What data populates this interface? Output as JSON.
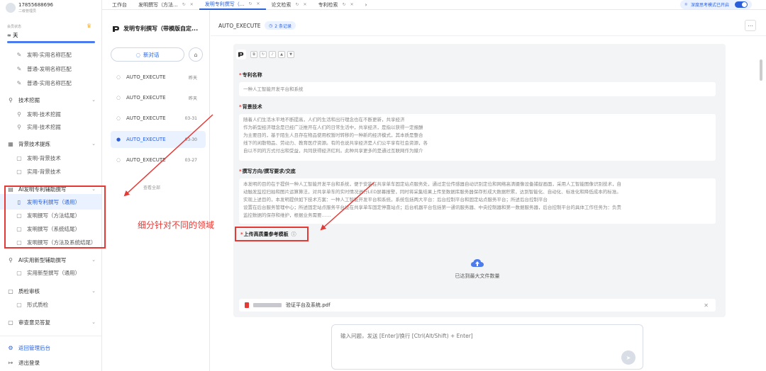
{
  "user": {
    "phone": "17855688696",
    "role": "二级管理员"
  },
  "member": {
    "label": "会员状态",
    "value": "∞ 天"
  },
  "sidebar": {
    "items_top": [
      {
        "label": "发明-实用名称匹配",
        "icon": "pen-icon"
      },
      {
        "label": "普通-发明名称匹配",
        "icon": "pen-icon"
      },
      {
        "label": "普通-实用名称匹配",
        "icon": "pen-icon"
      }
    ],
    "groups": [
      {
        "label": "技术挖掘",
        "items": [
          "发明-技术挖掘",
          "实用-技术挖掘"
        ]
      },
      {
        "label": "背景技术提炼",
        "items": [
          "发明-背景技术",
          "实用-背景技术"
        ]
      },
      {
        "label": "AI发明专利辅助撰写",
        "items": [
          "发明专利撰写（通用）",
          "发明撰写（方法结尾）",
          "发明撰写（系统结尾）",
          "发明撰写（方法及系统结尾）"
        ]
      },
      {
        "label": "AI实用新型辅助撰写",
        "items": [
          "实用新型撰写（通用）"
        ]
      },
      {
        "label": "质检审核",
        "items": [
          "形式质检"
        ]
      },
      {
        "label": "审查意见答复",
        "items": []
      }
    ],
    "footer": {
      "admin": "返回管理后台",
      "logout": "退出登录"
    }
  },
  "tabs": [
    {
      "label": "工作台",
      "active": false
    },
    {
      "label": "发明撰写（方法...",
      "active": false
    },
    {
      "label": "发明专利撰写（...",
      "active": true
    },
    {
      "label": "论文检索",
      "active": false
    },
    {
      "label": "专利检索",
      "active": false
    }
  ],
  "deep_think": {
    "label": "深度思考模式已开启"
  },
  "convo": {
    "title": "发明专利撰写（带模版自定...",
    "new_chat": "新对话",
    "items": [
      {
        "label": "AUTO_EXECUTE",
        "date": "昨天",
        "active": false
      },
      {
        "label": "AUTO_EXECUTE",
        "date": "昨天",
        "active": false
      },
      {
        "label": "AUTO_EXECUTE",
        "date": "03-31",
        "active": false
      },
      {
        "label": "AUTO_EXECUTE",
        "date": "03-30",
        "active": true
      },
      {
        "label": "AUTO_EXECUTE",
        "date": "03-27",
        "active": false
      }
    ],
    "view_all": "查看全部"
  },
  "main": {
    "title": "AUTO_EXECUTE",
    "record_badge": "2 条记录",
    "fields": {
      "name_label": "专利名称",
      "name_value": "一种人工智能开发平台和系统",
      "background_label": "背景技术",
      "background_lines": [
        "随着人们生活水平地不断提高，人们的生活和出行理念也在不断更新，共享经济",
        "作为新型经济理念是已经广泛推开在人们的日常生活中，共享经济，是指以获得一定报酬",
        "为主要目的，基于陌生人且存在物品使用权暂时转移的一种新的经济模式，其本质是整合",
        "线下的闲散物品、劳动力、教育医疗资源。有的也说共享经济是人们公平享有社会资源，各",
        "自以不同的方式付出和受益，共同获得经济红利。此种共享更多的是通过互联网作为媒介"
      ],
      "direction_label": "撰写方向/撰写要求/交底",
      "direction_lines": [
        "本发明的目的在于提供一种人工智能开发平台和系统，便于安装在共享单车固定站点服务处，通过定位传感器自动识别定位和网络高清摄像设备捕捉画面，采用人工智能图像识别技术，自",
        "动触发监控扫拍和图片运算算法，对共享单车的实时情况进行LED屏幕报警，同时将采集结果上传至数据库服务器保存形成大数据积累，达到智能化、自动化、标准化和降低成本的标准。",
        "实现上述目的，本发明提供如下技术方案：一种人工智能开发平台和系统，系统包括两大平台：后台控制平台和固定站点服务平台；所述后台控制平台",
        "设置在后台服务管理中心；所述固定站点服务平台设在共享单车固定停靠站点；后台机器平台包括第一通讯服务器、中央控制器和第一数据服务器，后台控制平台的具体工作任务为：负责",
        "监控数据的保存和维护，根据业务需要……"
      ],
      "upload_label": "上传高质量参考模板",
      "upload_max": "已达到最大文件数量",
      "file_name": "验证平台及系统.pdf"
    },
    "input_placeholder": "输入问题，发送 [Enter]/换行 [Ctrl(Alt/Shift) + Enter]"
  },
  "annotation": {
    "text": "细分针对不同的领域"
  },
  "colors": {
    "accent": "#2b5fd9",
    "annotation": "#e53935"
  }
}
